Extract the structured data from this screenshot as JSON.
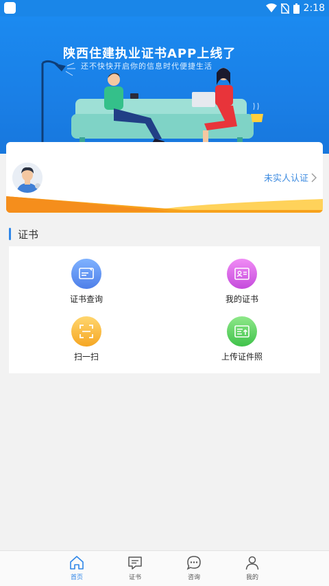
{
  "status_bar": {
    "time": "2:18"
  },
  "banner": {
    "title": "陕西住建执业证书APP上线了",
    "subtitle": "还不快快开启你的信息时代便捷生活"
  },
  "profile": {
    "verify_link": "未实人认证"
  },
  "section": {
    "title": "证书"
  },
  "grid": [
    {
      "label": "证书查询",
      "icon": "certificate-search-icon",
      "color_from": "#7fb2ff",
      "color_to": "#4e7fe9"
    },
    {
      "label": "我的证书",
      "icon": "id-card-icon",
      "color_from": "#f08cf5",
      "color_to": "#c54bdc"
    },
    {
      "label": "扫一扫",
      "icon": "scan-icon",
      "color_from": "#ffd66e",
      "color_to": "#f5a623"
    },
    {
      "label": "上传证件照",
      "icon": "upload-photo-icon",
      "color_from": "#8fe88a",
      "color_to": "#3fc24a"
    }
  ],
  "bottom_nav": [
    {
      "label": "首页",
      "icon": "home-icon",
      "active": true
    },
    {
      "label": "证书",
      "icon": "message-icon",
      "active": false
    },
    {
      "label": "咨询",
      "icon": "chat-icon",
      "active": false
    },
    {
      "label": "我的",
      "icon": "person-icon",
      "active": false
    }
  ],
  "colors": {
    "primary": "#1a86e8",
    "accent_blue": "#2f86e8",
    "page_bg": "#f2f2f2"
  }
}
